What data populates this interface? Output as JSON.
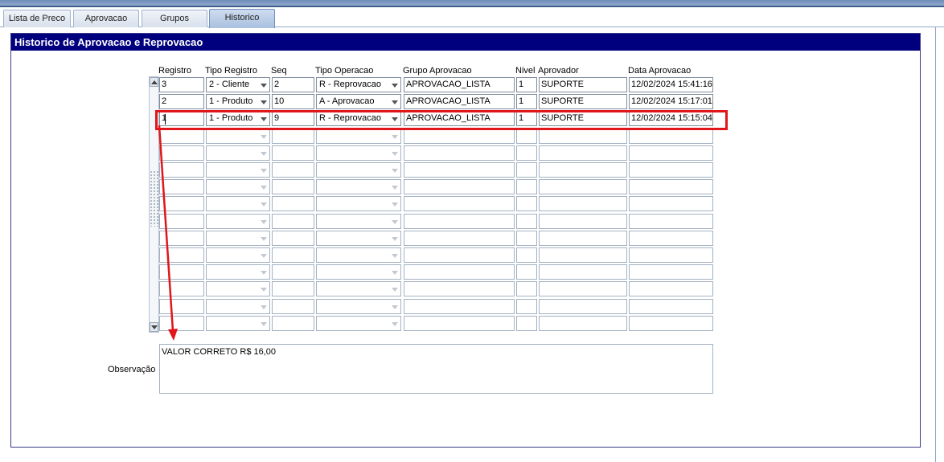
{
  "window_title": "",
  "tabs": [
    {
      "label": "Lista de Preco",
      "active": false
    },
    {
      "label": "Aprovacao",
      "active": false
    },
    {
      "label": "Grupos",
      "active": false
    },
    {
      "label": "Historico",
      "active": true
    }
  ],
  "panel": {
    "title": "Historico de Aprovacao e Reprovacao"
  },
  "columns": [
    "Registro",
    "Tipo Registro",
    "Seq",
    "Tipo Operacao",
    "Grupo Aprovacao",
    "Nivel",
    "Aprovador",
    "Data Aprovacao"
  ],
  "rows": [
    {
      "registro": "3",
      "tipo_registro": "2 - Cliente",
      "seq": "2",
      "tipo_operacao": "R - Reprovacao",
      "grupo": "APROVACAO_LISTA",
      "nivel": "1",
      "aprovador": "SUPORTE",
      "data": "12/02/2024 15:41:16"
    },
    {
      "registro": "2",
      "tipo_registro": "1 - Produto",
      "seq": "10",
      "tipo_operacao": "A - Aprovacao",
      "grupo": "APROVACAO_LISTA",
      "nivel": "1",
      "aprovador": "SUPORTE",
      "data": "12/02/2024 15:17:01"
    },
    {
      "registro": "1",
      "tipo_registro": "1 - Produto",
      "seq": "9",
      "tipo_operacao": "R - Reprovacao",
      "grupo": "APROVACAO_LISTA",
      "nivel": "1",
      "aprovador": "SUPORTE",
      "data": "12/02/2024 15:15:04"
    }
  ],
  "empty_row_count": 12,
  "observacao": {
    "label": "Observação",
    "value": "VALOR CORRETO R$ 16,00"
  },
  "annotation": {
    "highlight_color": "#e0161b"
  },
  "colors": {
    "title_bar": "#00007e",
    "title_text": "#ffffff",
    "tab_active": "#a9c0df"
  }
}
